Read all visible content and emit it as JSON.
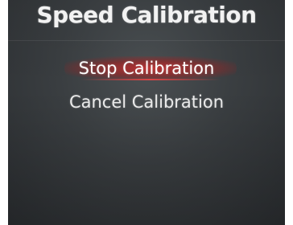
{
  "screen": {
    "title": "Speed Calibration"
  },
  "menu": {
    "items": [
      {
        "label": "Stop Calibration",
        "selected": true
      },
      {
        "label": "Cancel Calibration",
        "selected": false
      }
    ]
  },
  "colors": {
    "background": "#3a3e41",
    "highlight": "#cd2828",
    "text": "#f2f2f2"
  }
}
